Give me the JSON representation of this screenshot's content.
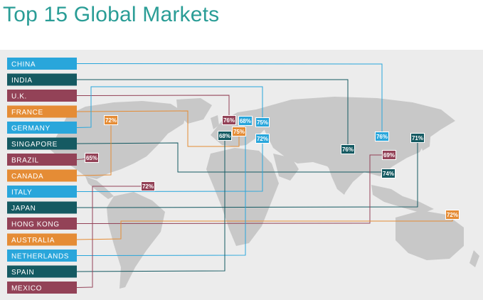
{
  "title": "Top 15 Global Markets",
  "colors": {
    "cyan": "#29a6db",
    "teal": "#155a62",
    "maroon": "#934257",
    "orange": "#e58c35",
    "land": "#c8c8c8",
    "ocean": "#ececec"
  },
  "chart_data": {
    "type": "table",
    "title": "Top 15 Global Markets",
    "markets": [
      {
        "country": "CHINA",
        "value": "76%",
        "color": "cyan"
      },
      {
        "country": "INDIA",
        "value": "76%",
        "color": "teal"
      },
      {
        "country": "U.K.",
        "value": "76%",
        "color": "maroon"
      },
      {
        "country": "FRANCE",
        "value": "75%",
        "color": "orange"
      },
      {
        "country": "GERMANY",
        "value": "75%",
        "color": "cyan"
      },
      {
        "country": "SINGAPORE",
        "value": "74%",
        "color": "teal"
      },
      {
        "country": "BRAZIL",
        "value": "65%",
        "color": "maroon"
      },
      {
        "country": "CANADA",
        "value": "72%",
        "color": "orange"
      },
      {
        "country": "ITALY",
        "value": "72%",
        "color": "cyan"
      },
      {
        "country": "JAPAN",
        "value": "71%",
        "color": "teal"
      },
      {
        "country": "HONG KONG",
        "value": "69%",
        "color": "maroon"
      },
      {
        "country": "AUSTRALIA",
        "value": "72%",
        "color": "orange"
      },
      {
        "country": "NETHERLANDS",
        "value": "68%",
        "color": "cyan"
      },
      {
        "country": "SPAIN",
        "value": "68%",
        "color": "teal"
      },
      {
        "country": "MEXICO",
        "value": "72%",
        "color": "maroon"
      }
    ]
  }
}
